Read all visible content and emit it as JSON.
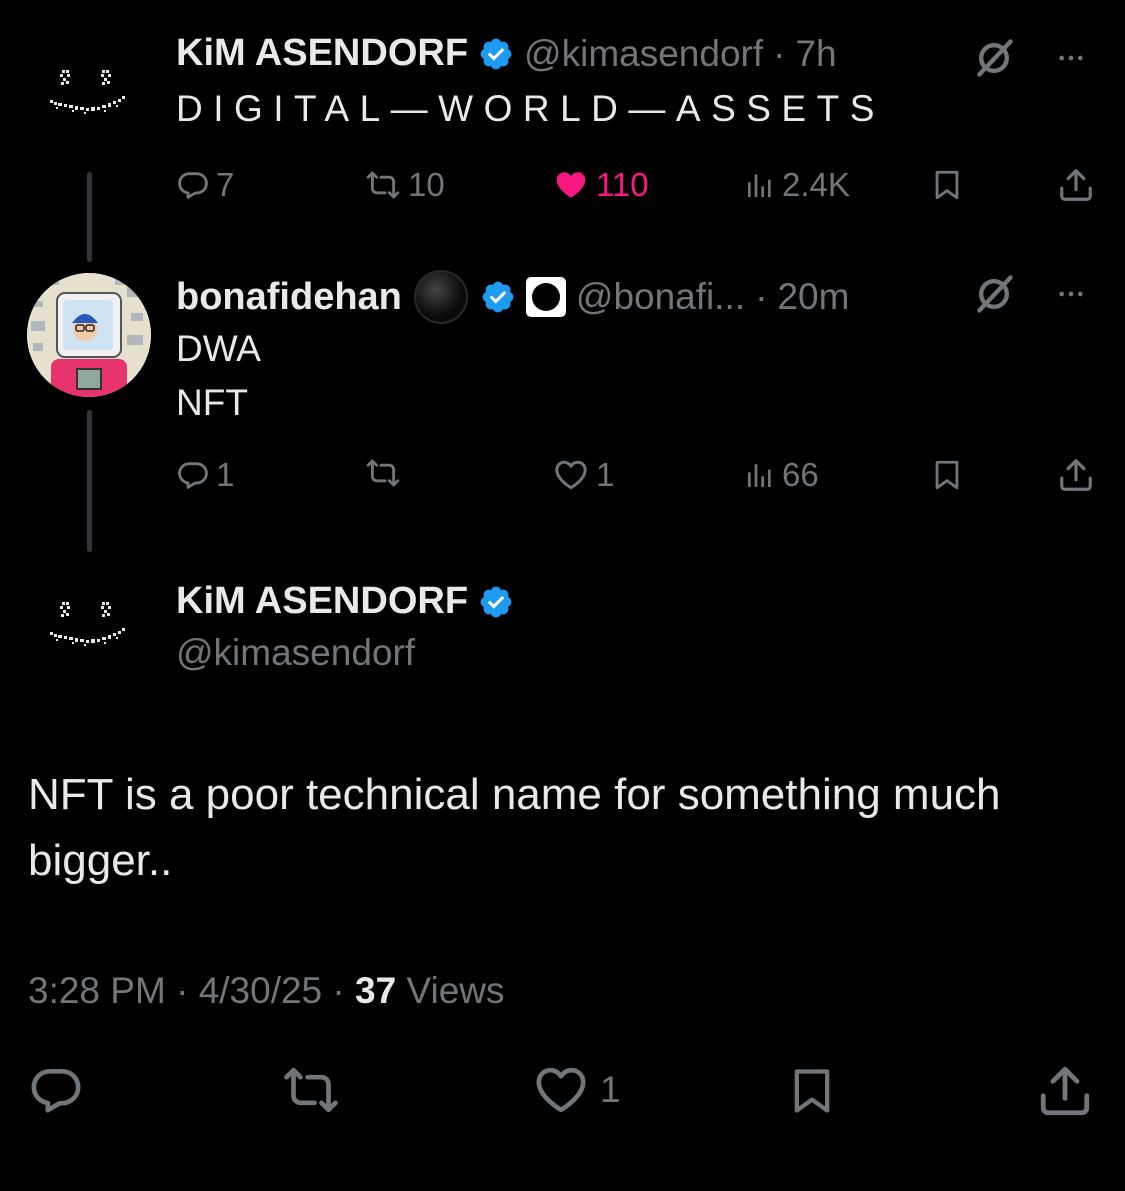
{
  "colors": {
    "background": "#000000",
    "text": "#e7e9ea",
    "muted": "#71767b",
    "verified": "#1d9bf0",
    "like": "#f91880",
    "thread_line": "#333639"
  },
  "tweet1": {
    "author_name": "KiM ASENDORF",
    "handle": "@kimasendorf",
    "sep": "·",
    "time": "7h",
    "text": "DIGITAL—WORLD—ASSETS",
    "replies": "7",
    "reposts": "10",
    "likes": "110",
    "views": "2.4K",
    "liked": true
  },
  "tweet2": {
    "author_name": "bonafidehan",
    "handle": "@bonafi...",
    "sep": "·",
    "time": "20m",
    "line1": "DWA",
    "line2": "NFT",
    "replies": "1",
    "reposts": "",
    "likes": "1",
    "views": "66"
  },
  "main_tweet": {
    "author_name": "KiM ASENDORF",
    "handle": "@kimasendorf",
    "text": "NFT is a poor technical name for something much bigger..",
    "time": "3:28 PM",
    "date": "4/30/25",
    "views_count": "37",
    "views_label": "Views",
    "likes": "1"
  },
  "icons": {
    "reply": "reply-icon",
    "repost": "repost-icon",
    "like": "heart-icon",
    "views": "views-icon",
    "bookmark": "bookmark-icon",
    "share": "share-icon",
    "grok": "grok-icon",
    "more": "more-icon",
    "verified": "verified-badge-icon"
  }
}
